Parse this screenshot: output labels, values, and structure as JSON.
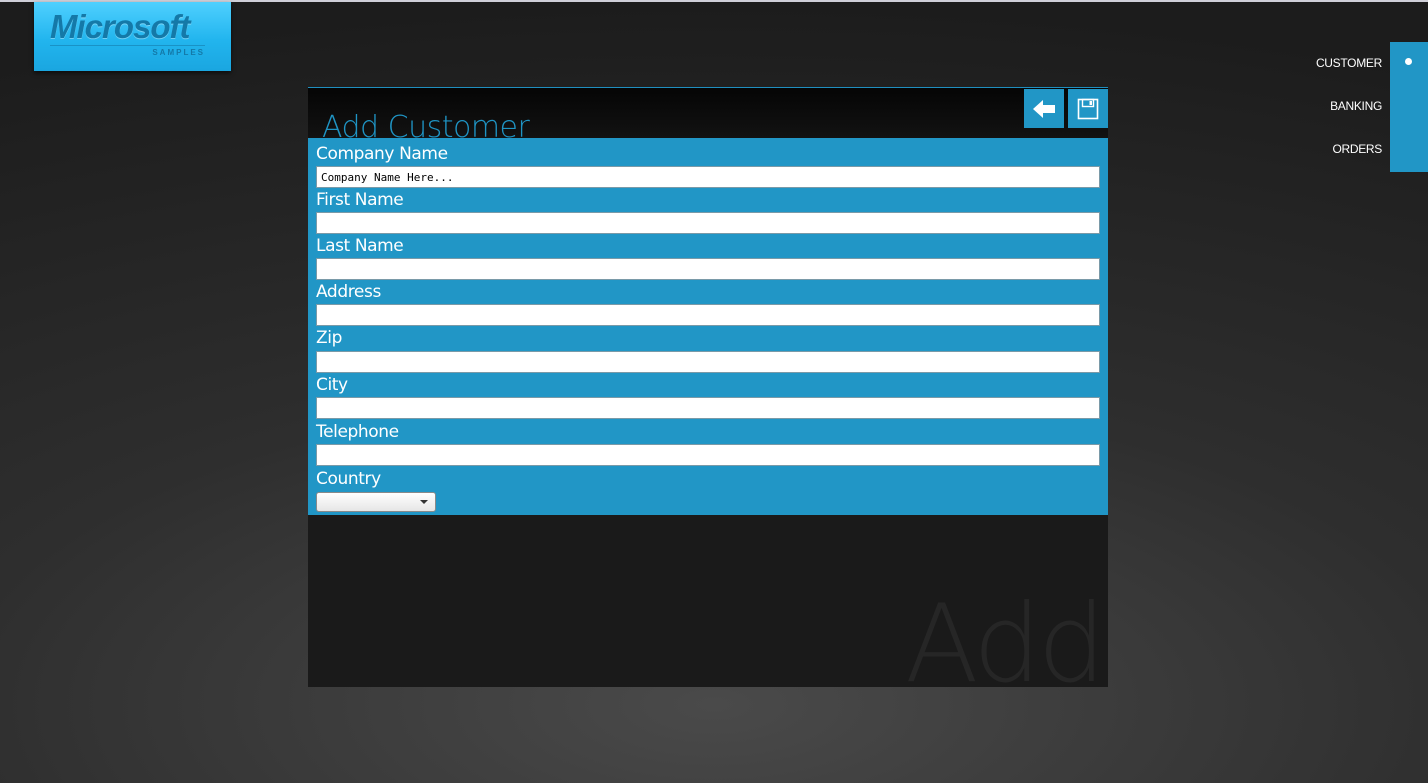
{
  "logo": {
    "brand": "Microsoft",
    "subtitle": "SAMPLES"
  },
  "panel": {
    "title": "Add Customer",
    "watermark": "Add",
    "buttons": {
      "back": "back-arrow-icon",
      "save": "floppy-disk-icon"
    }
  },
  "form": {
    "fields": [
      {
        "label": "Company Name",
        "value": "Company Name Here..."
      },
      {
        "label": "First Name",
        "value": ""
      },
      {
        "label": "Last Name",
        "value": ""
      },
      {
        "label": "Address",
        "value": ""
      },
      {
        "label": "Zip",
        "value": ""
      },
      {
        "label": "City",
        "value": ""
      },
      {
        "label": "Telephone",
        "value": ""
      }
    ],
    "country": {
      "label": "Country",
      "selected": ""
    }
  },
  "nav": {
    "items": [
      {
        "label": "CUSTOMER"
      },
      {
        "label": "BANKING"
      },
      {
        "label": "ORDERS"
      }
    ],
    "active_index": 0
  },
  "colors": {
    "accent": "#2196c6",
    "panel_bg": "#1a1a1a",
    "logo": "#22b5ee"
  }
}
